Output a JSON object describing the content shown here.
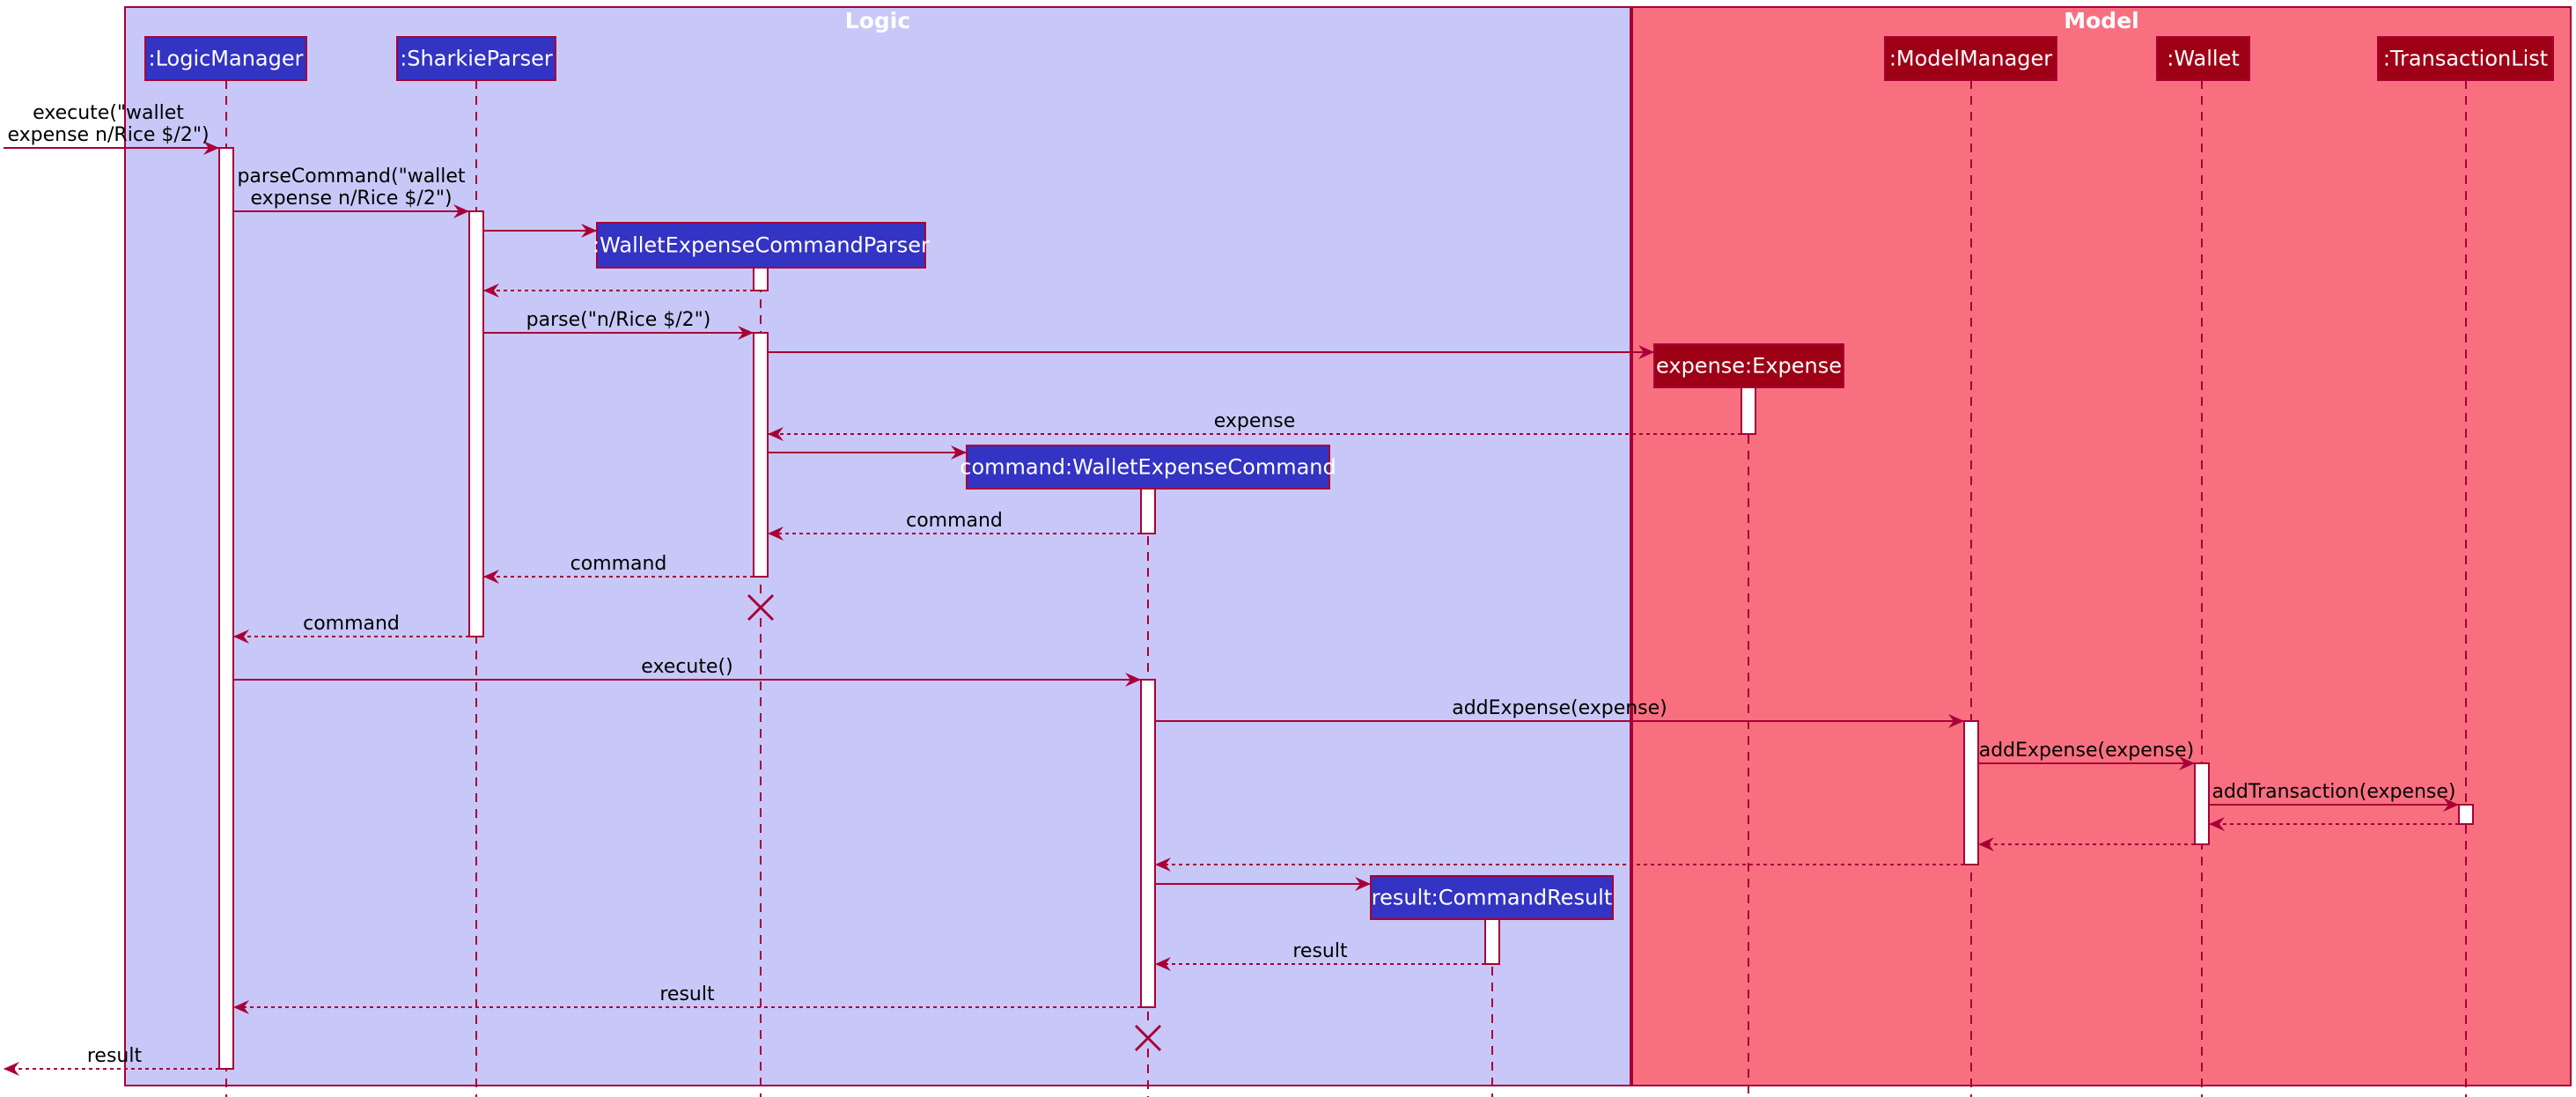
{
  "diagram": {
    "type": "sequence",
    "colors": {
      "line": "#A80036",
      "logic_background": "#C8C8F8",
      "logic_participant": "#3333C4",
      "model_background": "#F87080",
      "model_participant": "#9E0016",
      "activation": "#FFFFFF",
      "text_dark": "#000000",
      "text_light": "#FFFFFF"
    },
    "frames": [
      {
        "id": "logic",
        "title": "Logic"
      },
      {
        "id": "model",
        "title": "Model"
      }
    ],
    "participants": [
      {
        "id": "lm",
        "label": ":LogicManager",
        "frame": "logic"
      },
      {
        "id": "sp",
        "label": ":SharkieParser",
        "frame": "logic"
      },
      {
        "id": "wecp",
        "label": ":WalletExpenseCommandParser",
        "frame": "logic",
        "created": true,
        "destroyed": true
      },
      {
        "id": "cmd",
        "label": "command:WalletExpenseCommand",
        "frame": "logic",
        "created": true,
        "destroyed": true
      },
      {
        "id": "res",
        "label": "result:CommandResult",
        "frame": "logic",
        "created": true
      },
      {
        "id": "exp",
        "label": "expense:Expense",
        "frame": "model",
        "created": true
      },
      {
        "id": "mm",
        "label": ":ModelManager",
        "frame": "model"
      },
      {
        "id": "wal",
        "label": ":Wallet",
        "frame": "model"
      },
      {
        "id": "tl",
        "label": ":TransactionList",
        "frame": "model"
      }
    ],
    "messages": [
      {
        "from": "external",
        "to": "lm",
        "kind": "call",
        "label_lines": [
          "execute(\"wallet",
          "expense n/Rice $/2\")"
        ]
      },
      {
        "from": "lm",
        "to": "sp",
        "kind": "call",
        "label_lines": [
          "parseCommand(\"wallet",
          "expense n/Rice $/2\")"
        ]
      },
      {
        "from": "sp",
        "to": "wecp",
        "kind": "create",
        "label_lines": []
      },
      {
        "from": "wecp",
        "to": "sp",
        "kind": "return",
        "label_lines": []
      },
      {
        "from": "sp",
        "to": "wecp",
        "kind": "call",
        "label_lines": [
          "parse(\"n/Rice $/2\")"
        ]
      },
      {
        "from": "wecp",
        "to": "exp",
        "kind": "create",
        "label_lines": []
      },
      {
        "from": "exp",
        "to": "wecp",
        "kind": "return",
        "label_lines": [
          "expense"
        ]
      },
      {
        "from": "wecp",
        "to": "cmd",
        "kind": "create",
        "label_lines": []
      },
      {
        "from": "cmd",
        "to": "wecp",
        "kind": "return",
        "label_lines": [
          "command"
        ]
      },
      {
        "from": "wecp",
        "to": "sp",
        "kind": "return",
        "label_lines": [
          "command"
        ]
      },
      {
        "from": "sp",
        "to": "lm",
        "kind": "return",
        "label_lines": [
          "command"
        ]
      },
      {
        "from": "lm",
        "to": "cmd",
        "kind": "call",
        "label_lines": [
          "execute()"
        ]
      },
      {
        "from": "cmd",
        "to": "mm",
        "kind": "call",
        "label_lines": [
          "addExpense(expense)"
        ]
      },
      {
        "from": "mm",
        "to": "wal",
        "kind": "call",
        "label_lines": [
          "addExpense(expense)"
        ]
      },
      {
        "from": "wal",
        "to": "tl",
        "kind": "call",
        "label_lines": [
          "addTransaction(expense)"
        ]
      },
      {
        "from": "tl",
        "to": "wal",
        "kind": "return",
        "label_lines": []
      },
      {
        "from": "wal",
        "to": "mm",
        "kind": "return",
        "label_lines": []
      },
      {
        "from": "mm",
        "to": "cmd",
        "kind": "return",
        "label_lines": []
      },
      {
        "from": "cmd",
        "to": "res",
        "kind": "create",
        "label_lines": []
      },
      {
        "from": "res",
        "to": "cmd",
        "kind": "return",
        "label_lines": [
          "result"
        ]
      },
      {
        "from": "cmd",
        "to": "lm",
        "kind": "return",
        "label_lines": [
          "result"
        ]
      },
      {
        "from": "lm",
        "to": "external",
        "kind": "return",
        "label_lines": [
          "result"
        ]
      }
    ]
  }
}
